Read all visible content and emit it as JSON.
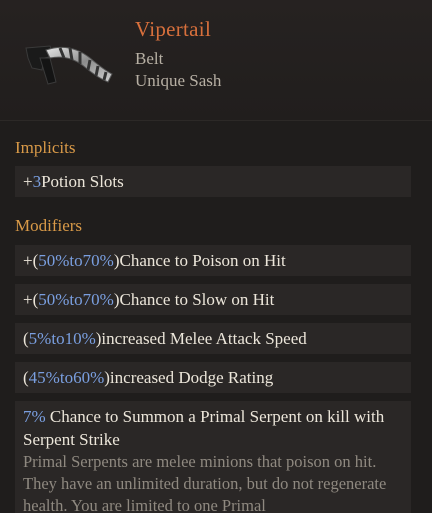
{
  "item": {
    "name": "Vipertail",
    "type": "Belt",
    "subtype": "Unique Sash",
    "icon": "belt-icon"
  },
  "implicits": {
    "title": "Implicits",
    "items": [
      {
        "prefix": "+",
        "value": "3",
        "text": " Potion Slots"
      }
    ]
  },
  "modifiers": {
    "title": "Modifiers",
    "items": [
      {
        "pre": "+(",
        "min": "50%",
        "to": " to ",
        "max": "70%",
        "post": ")",
        "text": " Chance to Poison on Hit"
      },
      {
        "pre": "+(",
        "min": "50%",
        "to": " to ",
        "max": "70%",
        "post": ")",
        "text": " Chance to Slow on Hit"
      },
      {
        "pre": "(",
        "min": "5%",
        "to": " to ",
        "max": "10%",
        "post": ")",
        "text": " increased Melee Attack Speed"
      },
      {
        "pre": "(",
        "min": "45%",
        "to": " to ",
        "max": "60%",
        "post": ")",
        "text": " increased Dodge Rating"
      }
    ],
    "special": {
      "value": "7%",
      "text": " Chance to Summon a Primal Serpent on kill with Serpent Strike",
      "description": "Primal Serpents are melee minions that poison on hit. They have an unlimited duration, but do not regenerate health. You are limited to one Primal"
    }
  },
  "colors": {
    "name": "#d8703c",
    "section": "#d99a48",
    "value": "#7a9fe0",
    "description": "#8f8980"
  }
}
